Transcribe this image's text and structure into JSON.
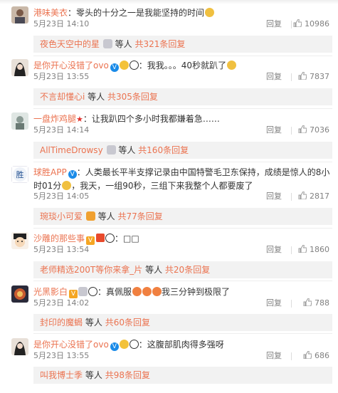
{
  "comments": [
    {
      "user": "港味美衣",
      "text": "：零头的十分之一是我能坚持的时间",
      "date": "5月23日 14:10",
      "reply": "回复",
      "likes": "10986",
      "sub_user": "夜色天空中的星",
      "sub_mid": "等人",
      "sub_more": "共321条回复"
    },
    {
      "user": "是你开心没错了ovo",
      "text": "：我我。。。40秒就趴了",
      "date": "5月23日 13:55",
      "reply": "回复",
      "likes": "7837",
      "sub_user": "不言却懂心i",
      "sub_mid": "等人",
      "sub_more": "共305条回复"
    },
    {
      "user": "一盘炸鸡腿",
      "text": "：让我趴四个多小时我都嫌着急……",
      "date": "5月23日 14:14",
      "reply": "回复",
      "likes": "7036",
      "sub_user": "AllTimeDrowsy",
      "sub_mid": "等人",
      "sub_more": "共160条回复"
    },
    {
      "user": "球胜APP",
      "text": "：人类最长平半支撑记录由中国特警毛卫东保持，成绩是惊人的8小时01分",
      "text2": "，我天，一组90秒，三组下来我整个人都要废了",
      "date": "5月23日 14:05",
      "reply": "回复",
      "likes": "2817",
      "sub_user": "琬琰小可爱",
      "sub_mid": "等人",
      "sub_more": "共77条回复"
    },
    {
      "user": "沙雕的那些事",
      "text": "：□□",
      "date": "5月23日 13:54",
      "reply": "回复",
      "likes": "1860",
      "sub_user": "老师精选200T等你来拿_片",
      "sub_mid": "等人",
      "sub_more": "共20条回复"
    },
    {
      "user": "光黑影白",
      "text": "：真佩服",
      "text2": "我三分钟到极限了",
      "date": "5月23日 14:02",
      "reply": "回复",
      "likes": "788",
      "sub_user": "封印的魔蝎",
      "sub_mid": "等人",
      "sub_more": "共60条回复"
    },
    {
      "user": "是你开心没错了ovo",
      "text": "：这腹部肌肉得多强呀",
      "date": "5月23日 13:55",
      "reply": "回复",
      "likes": "686",
      "sub_user": "叫我博士季",
      "sub_mid": "等人",
      "sub_more": "共98条回复"
    }
  ],
  "colors": {
    "username": "#eb7350",
    "meta": "#808080",
    "subbox_bg": "#f2f2f2",
    "vbadge": "#1a8be8"
  }
}
